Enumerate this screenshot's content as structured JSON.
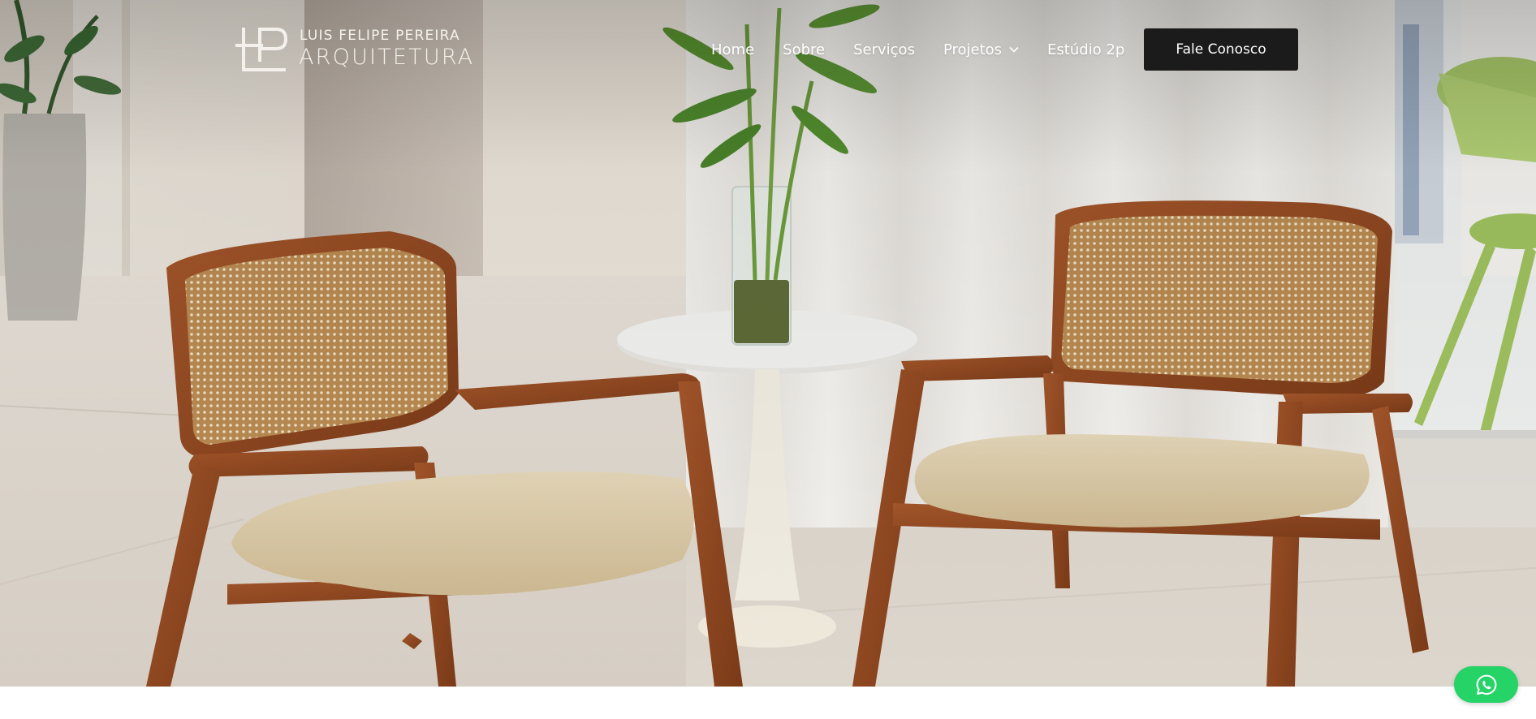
{
  "brand": {
    "name_top": "LUIS FELIPE PEREIRA",
    "name_bottom": "ARQUITETURA",
    "logo_icon": "lfp-monogram-icon"
  },
  "nav": {
    "items": [
      {
        "label": "Home"
      },
      {
        "label": "Sobre"
      },
      {
        "label": "Serviços"
      },
      {
        "label": "Projetos",
        "has_dropdown": true,
        "icon": "chevron-down-icon"
      },
      {
        "label": "Estúdio 2p"
      }
    ],
    "cta_label": "Fale Conosco"
  },
  "hero": {
    "image_subject": "two-wooden-cane-armchairs-with-marble-side-table"
  },
  "floating": {
    "whatsapp_icon": "whatsapp-icon"
  },
  "colors": {
    "cta_background": "#1b1b1b",
    "whatsapp_green": "#25d366",
    "nav_text": "#ffffff"
  }
}
